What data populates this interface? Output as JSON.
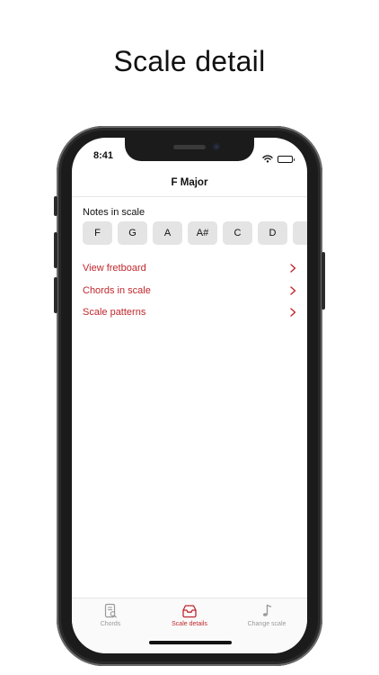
{
  "promo": {
    "headline": "Scale detail"
  },
  "status_bar": {
    "time": "8:41",
    "icons": [
      "wifi-icon",
      "battery-icon"
    ]
  },
  "nav": {
    "title": "F Major"
  },
  "notes": {
    "label": "Notes in scale",
    "items": [
      "F",
      "G",
      "A",
      "A#",
      "C",
      "D",
      ""
    ]
  },
  "menu": {
    "items": [
      {
        "label": "View fretboard",
        "icon": "chevron-right-icon"
      },
      {
        "label": "Chords in scale",
        "icon": "chevron-right-icon"
      },
      {
        "label": "Scale patterns",
        "icon": "chevron-right-icon"
      }
    ]
  },
  "tabbar": {
    "tabs": [
      {
        "label": "Chords",
        "icon": "document-search-icon",
        "active": false
      },
      {
        "label": "Scale details",
        "icon": "inbox-tray-icon",
        "active": true
      },
      {
        "label": "Change scale",
        "icon": "music-note-icon",
        "active": false
      }
    ]
  },
  "colors": {
    "accent": "#c0272d",
    "inactive": "#9a9a9a",
    "note_chip": "#e4e4e4",
    "phone_body": "#1b1b1b"
  }
}
